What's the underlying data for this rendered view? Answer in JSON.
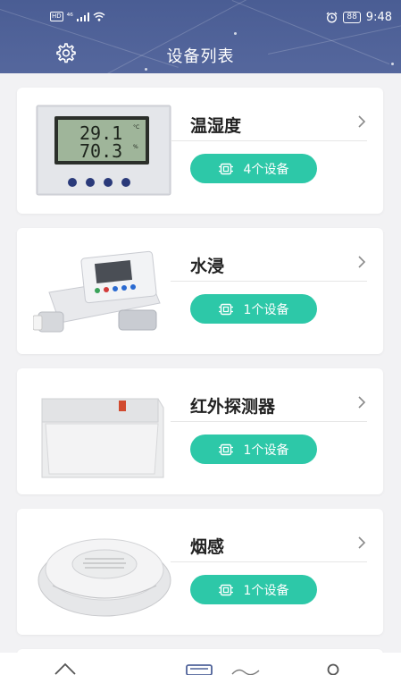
{
  "status_bar": {
    "signal_text": "⁴⁶",
    "hd_badge": "HD",
    "battery": "88",
    "time": "9:48"
  },
  "header": {
    "title": "设备列表",
    "settings_icon": "gear-icon"
  },
  "devices": [
    {
      "name": "温湿度",
      "count_label": "4个设备",
      "image": "thermo-hygrometer"
    },
    {
      "name": "水浸",
      "count_label": "1个设备",
      "image": "water-leak-sensor"
    },
    {
      "name": "红外探测器",
      "count_label": "1个设备",
      "image": "infrared-detector"
    },
    {
      "name": "烟感",
      "count_label": "1个设备",
      "image": "smoke-detector"
    }
  ],
  "colors": {
    "header_bg": "#4f6299",
    "accent": "#2dc8a8",
    "background": "#f2f2f4"
  },
  "bottom_nav": {
    "icons": [
      "home-icon",
      "device-list-icon",
      "scene-icon",
      "profile-icon"
    ]
  }
}
